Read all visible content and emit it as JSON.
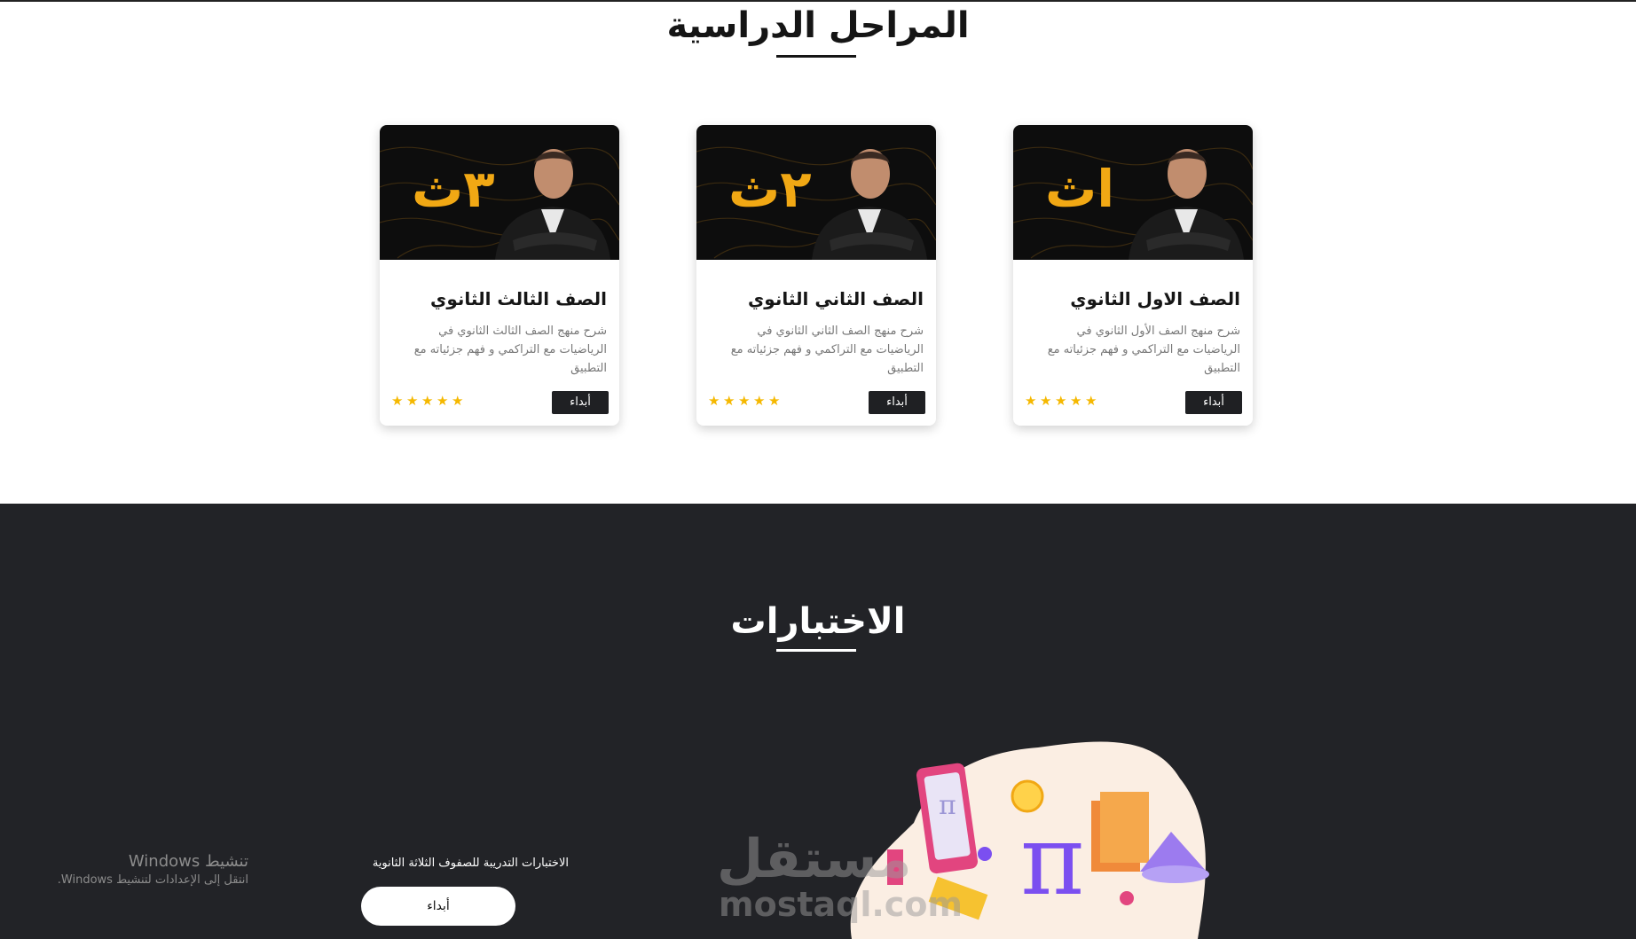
{
  "stages": {
    "title": "المراحل الدراسية",
    "cards": [
      {
        "grade_badge": "اث",
        "title": "الصف الاول الثانوي",
        "description": "شرح منهج الصف الأول الثانوي في الرياضيات مع التراكمي و فهم جزئياته مع التطبيق",
        "button_label": "أبداء",
        "rating": 5
      },
      {
        "grade_badge": "٢ث",
        "title": "الصف الثاني الثانوي",
        "description": "شرح منهج الصف الثاني الثانوي في الرياضيات مع التراكمي و فهم جزئياته مع التطبيق",
        "button_label": "أبداء",
        "rating": 5
      },
      {
        "grade_badge": "٣ث",
        "title": "الصف الثالث الثانوي",
        "description": "شرح منهج الصف الثالث الثانوي في الرياضيات مع التراكمي و فهم جزئياته مع التطبيق",
        "button_label": "أبداء",
        "rating": 5
      }
    ],
    "star_glyph": "★",
    "star_color": "#f5b800",
    "badge_color": "#f1a814"
  },
  "exams": {
    "title": "الاختبارات",
    "description": "الاختبارات التدريبة للصفوف الثلاثة الثانوية",
    "button_label": "أبداء"
  },
  "watermark": {
    "arabic": "مستقل",
    "latin": "mostaql.com"
  },
  "windows_activation": {
    "line1": "تنشيط Windows",
    "line2": "انتقل إلى الإعدادات لتنشيط Windows."
  },
  "colors": {
    "dark_background": "#222327",
    "text_dark": "#151515"
  }
}
